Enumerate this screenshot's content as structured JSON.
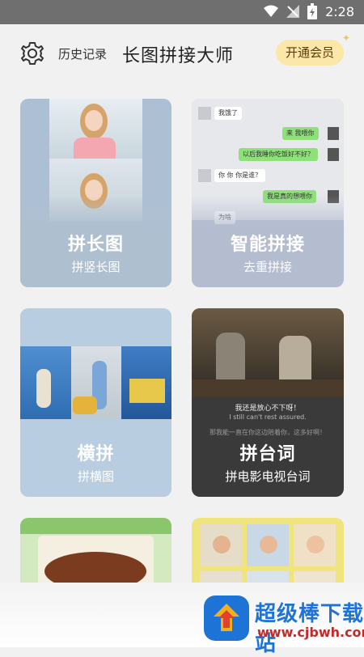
{
  "status_bar": {
    "time": "2:28",
    "icons": [
      "wifi-icon",
      "signal-icon",
      "battery-charging-icon"
    ]
  },
  "header": {
    "settings_icon": "gear-icon",
    "history_label": "历史记录",
    "title": "长图拼接大师",
    "vip_button": "开通会员"
  },
  "cards": [
    {
      "title": "拼长图",
      "subtitle": "拼竖长图"
    },
    {
      "title": "智能拼接",
      "subtitle": "去重拼接",
      "chat": [
        "我饿了",
        "来 我喂你",
        "以后我睡你吃饭好不好？",
        "你 你 你是谁？",
        "我是真的想喂你",
        "为啥"
      ]
    },
    {
      "title": "横拼",
      "subtitle": "拼横图"
    },
    {
      "title": "拼台词",
      "subtitle": "拼电影电视台词",
      "subtitle_cn": "我还是放心不下呀！",
      "subtitle_en": "I still can't rest assured.",
      "subtitle2_cn": "那我能一直在你这边陪着你，这多好啊！"
    },
    {
      "title": "",
      "subtitle": ""
    },
    {
      "title": "",
      "subtitle": ""
    }
  ],
  "watermark": {
    "main": "超级棒下载站",
    "sub": "www.cjbwh.com"
  },
  "colors": {
    "vip_bg": "#fbe7a8",
    "watermark_blue": "#1e73d6",
    "watermark_red": "#c12b2b"
  }
}
